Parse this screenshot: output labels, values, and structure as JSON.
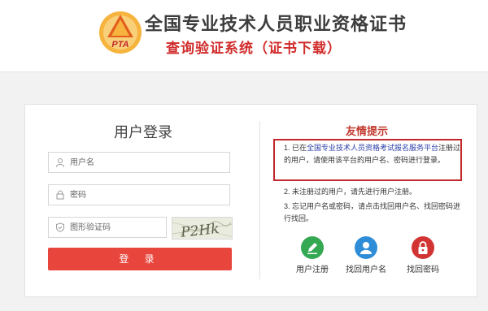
{
  "header": {
    "logo_text": "PTA",
    "title": "全国专业技术人员职业资格证书",
    "subtitle": "查询验证系统（证书下载）"
  },
  "login": {
    "title": "用户登录",
    "username_placeholder": "用户名",
    "password_placeholder": "密码",
    "captcha_placeholder": "图形验证码",
    "captcha_text": "P2Hk",
    "login_label": "登 录"
  },
  "tips": {
    "title": "友情提示",
    "tip1_prefix": "1. 已在",
    "tip1_link": "全国专业技术人员资格考试报名服务平台",
    "tip1_suffix": "注册过的用户，请使用该平台的用户名、密码进行登录。",
    "tip2": "2. 未注册过的用户，请先进行用户注册。",
    "tip3": "3. 忘记用户名或密码，请点击找回用户名、找回密码进行找回。"
  },
  "actions": {
    "register": {
      "label": "用户注册",
      "icon": "pencil-icon",
      "color": "#34a853"
    },
    "find_username": {
      "label": "找回用户名",
      "icon": "user-icon",
      "color": "#2f8dd8"
    },
    "find_password": {
      "label": "找回密码",
      "icon": "lock-icon",
      "color": "#d23434"
    }
  },
  "colors": {
    "accent_red": "#e8453c",
    "title_red": "#d12b2b",
    "logo_orange": "#f0a030"
  }
}
